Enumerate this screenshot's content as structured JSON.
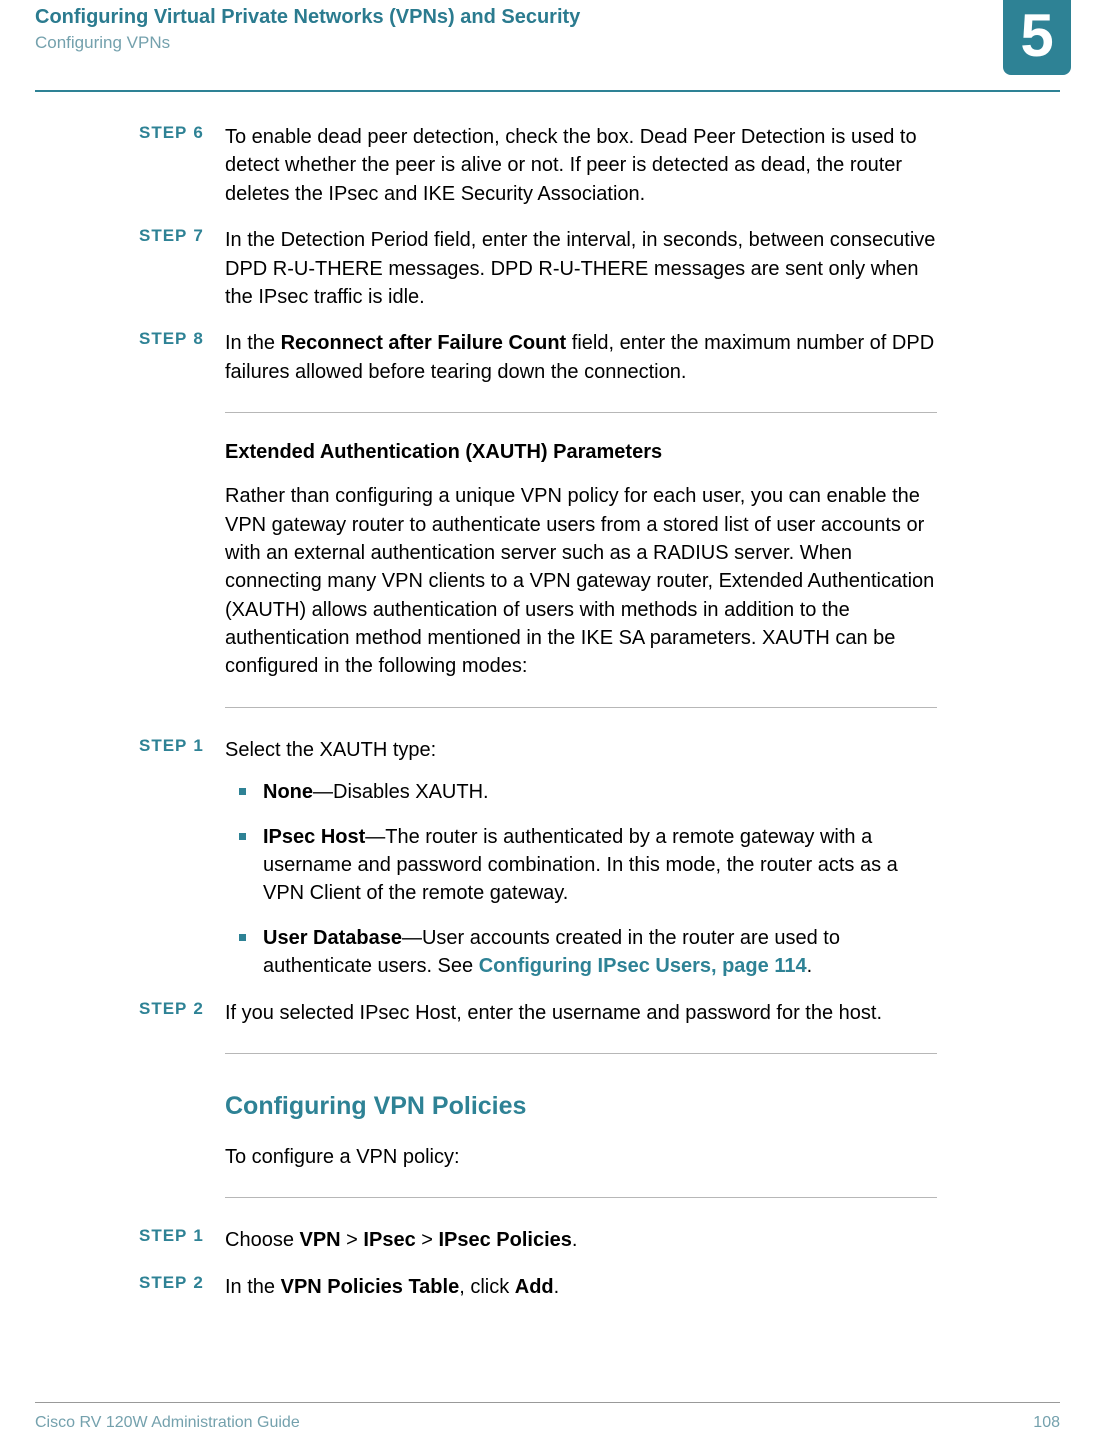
{
  "header": {
    "title": "Configuring Virtual Private Networks (VPNs) and Security",
    "sub": "Configuring VPNs",
    "chapter": "5"
  },
  "steps_a": [
    {
      "num": "6",
      "body": "To enable dead peer detection, check the box. Dead Peer Detection is used to detect whether the peer is alive or not. If peer is detected as dead, the router deletes the IPsec and IKE Security Association."
    },
    {
      "num": "7",
      "body": "In the Detection Period field, enter the interval, in seconds, between consecutive DPD R-U-THERE messages. DPD R-U-THERE messages are sent only when the IPsec traffic is idle."
    },
    {
      "num": "8",
      "html": "In the <span class='bold'>Reconnect after Failure Count</span> field, enter the maximum number of DPD failures allowed before tearing down the connection."
    }
  ],
  "xauth": {
    "heading": "Extended Authentication (XAUTH) Parameters",
    "para": "Rather than configuring a unique VPN policy for each user, you can enable the VPN gateway router to authenticate users from a stored list of user accounts or with an external authentication server such as a RADIUS server. When connecting many VPN clients to a VPN gateway router, Extended Authentication (XAUTH) allows authentication of users with methods in addition to the authentication method mentioned in the IKE SA parameters. XAUTH can be configured in the following modes:"
  },
  "steps_b": [
    {
      "num": "1",
      "body": "Select the XAUTH type:",
      "bullets": [
        {
          "html": "<span class='bold'>None</span>—Disables XAUTH."
        },
        {
          "html": "<span class='bold'>IPsec Host</span>—The router is authenticated by a remote gateway with a username and password combination. In this mode, the router acts as a VPN Client of the remote gateway."
        },
        {
          "html": "<span class='bold'>User Database</span>—User accounts created in the router are used to authenticate users. See <span class='link' data-name='link-ipsec-users' data-interactable='true'>Configuring IPsec Users, page 114</span>."
        }
      ]
    },
    {
      "num": "2",
      "body": "If you selected IPsec Host, enter the username and password for the host."
    }
  ],
  "section2": {
    "heading": "Configuring VPN Policies",
    "intro": "To configure a VPN policy:"
  },
  "steps_c": [
    {
      "num": "1",
      "html": "Choose <span class='bold'>VPN</span> &gt; <span class='bold'>IPsec</span> &gt; <span class='bold'>IPsec Policies</span>."
    },
    {
      "num": "2",
      "html": "In the <span class='bold'>VPN Policies Table</span>, click <span class='bold'>Add</span>."
    }
  ],
  "footer": {
    "left": "Cisco RV 120W Administration Guide",
    "right": "108"
  },
  "labels": {
    "step": "STEP"
  }
}
